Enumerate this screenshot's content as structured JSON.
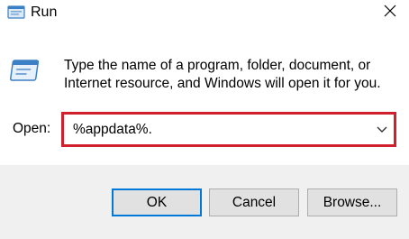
{
  "window": {
    "title": "Run",
    "icon": "run-app-icon",
    "close_icon": "close-icon"
  },
  "main": {
    "description": "Type the name of a program, folder, document, or Internet resource, and Windows will open it for you.",
    "icon": "run-dialog-icon",
    "open_label": "Open:",
    "open_value": "%appdata%.",
    "dropdown_icon": "chevron-down-icon",
    "highlight_color": "#d0202e"
  },
  "buttons": {
    "ok": "OK",
    "cancel": "Cancel",
    "browse": "Browse..."
  },
  "colors": {
    "accent": "#0078d7",
    "footer_bg": "#f0f0f0",
    "button_bg": "#e1e1e1"
  }
}
